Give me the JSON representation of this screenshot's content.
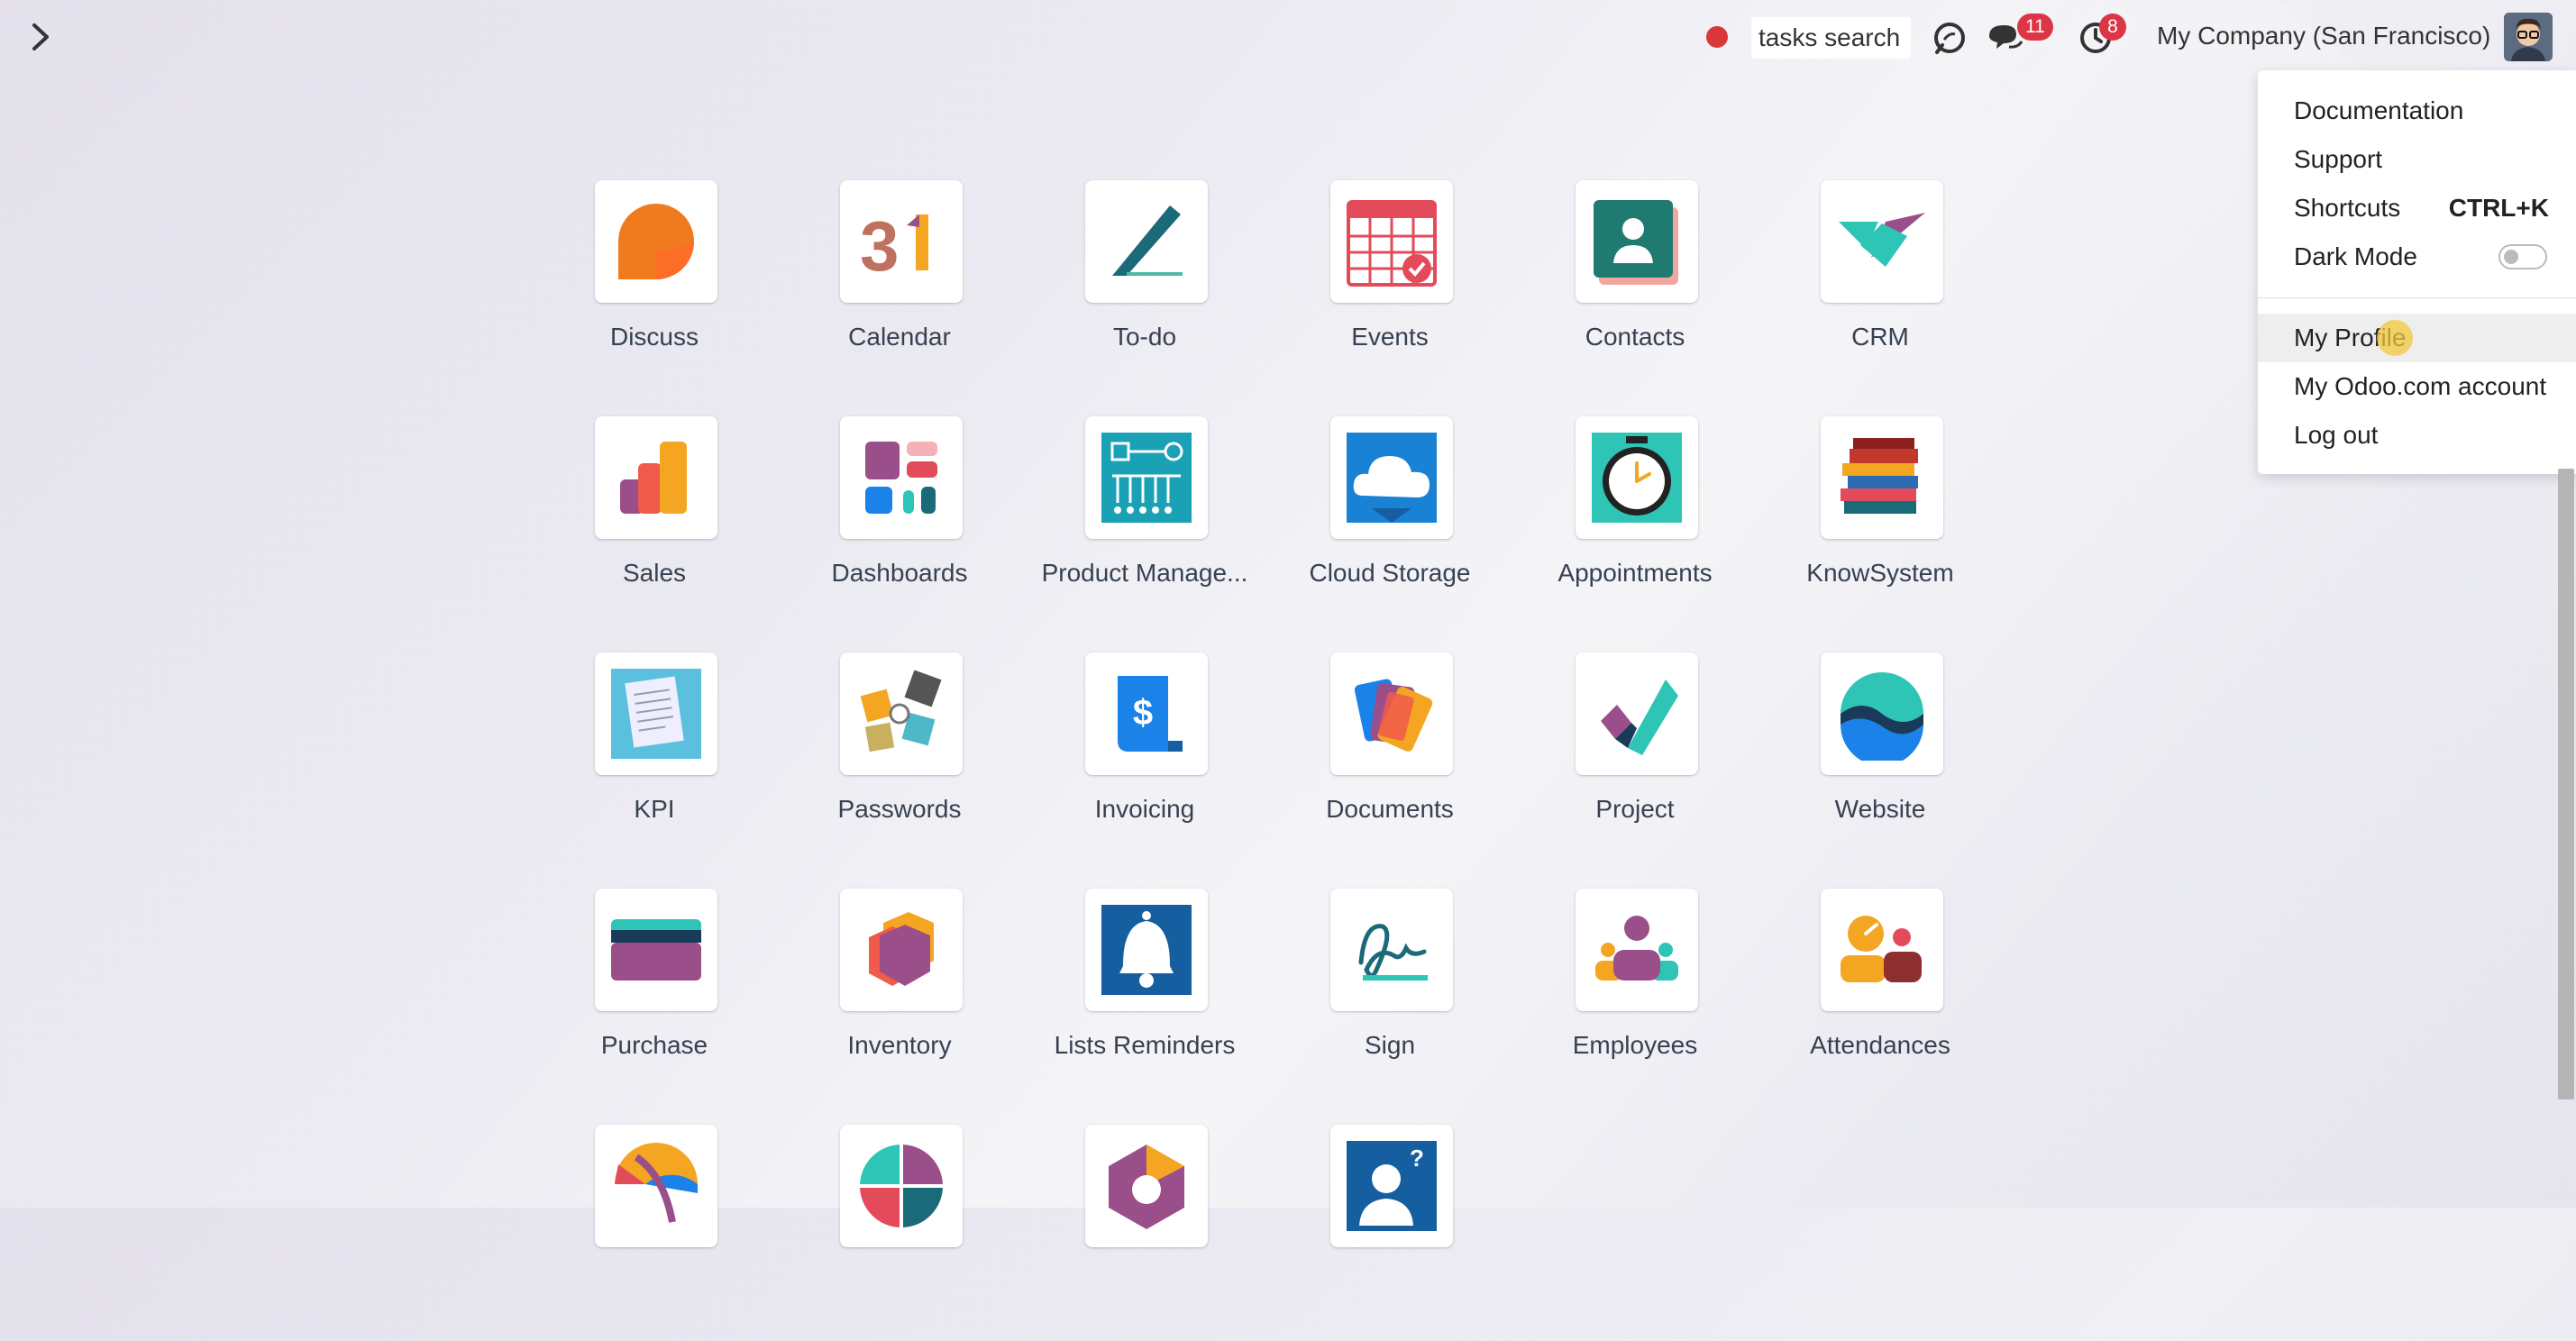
{
  "systray": {
    "search_text": "tasks search",
    "messages_count": "11",
    "activities_count": "8",
    "company": "My Company (San Francisco)"
  },
  "apps": [
    {
      "label": "Discuss",
      "icon": "discuss-icon"
    },
    {
      "label": "Calendar",
      "icon": "calendar-icon",
      "glyph": "31"
    },
    {
      "label": "To-do",
      "icon": "todo-icon"
    },
    {
      "label": "Events",
      "icon": "events-icon"
    },
    {
      "label": "Contacts",
      "icon": "contacts-icon"
    },
    {
      "label": "CRM",
      "icon": "crm-icon"
    },
    {
      "label": "Sales",
      "icon": "sales-icon"
    },
    {
      "label": "Dashboards",
      "icon": "dashboards-icon"
    },
    {
      "label": "Product Manage...",
      "icon": "product-management-icon"
    },
    {
      "label": "Cloud Storage",
      "icon": "cloud-storage-icon"
    },
    {
      "label": "Appointments",
      "icon": "appointments-icon"
    },
    {
      "label": "KnowSystem",
      "icon": "knowsystem-icon"
    },
    {
      "label": "KPI",
      "icon": "kpi-icon"
    },
    {
      "label": "Passwords",
      "icon": "passwords-icon"
    },
    {
      "label": "Invoicing",
      "icon": "invoicing-icon",
      "glyph": "$"
    },
    {
      "label": "Documents",
      "icon": "documents-icon"
    },
    {
      "label": "Project",
      "icon": "project-icon"
    },
    {
      "label": "Website",
      "icon": "website-icon"
    },
    {
      "label": "Purchase",
      "icon": "purchase-icon"
    },
    {
      "label": "Inventory",
      "icon": "inventory-icon"
    },
    {
      "label": "Lists Reminders",
      "icon": "lists-reminders-icon"
    },
    {
      "label": "Sign",
      "icon": "sign-icon"
    },
    {
      "label": "Employees",
      "icon": "employees-icon"
    },
    {
      "label": "Attendances",
      "icon": "attendances-icon"
    },
    {
      "label": "",
      "icon": "time-off-icon"
    },
    {
      "label": "",
      "icon": "planning-icon"
    },
    {
      "label": "",
      "icon": "referrals-icon"
    },
    {
      "label": "",
      "icon": "helpdesk-icon",
      "glyph": "?"
    }
  ],
  "user_menu": {
    "documentation": "Documentation",
    "support": "Support",
    "shortcuts": "Shortcuts",
    "shortcuts_key": "CTRL+K",
    "dark_mode": "Dark Mode",
    "dark_mode_on": false,
    "my_profile": "My Profile",
    "odoo_account": "My Odoo.com account",
    "log_out": "Log out"
  }
}
